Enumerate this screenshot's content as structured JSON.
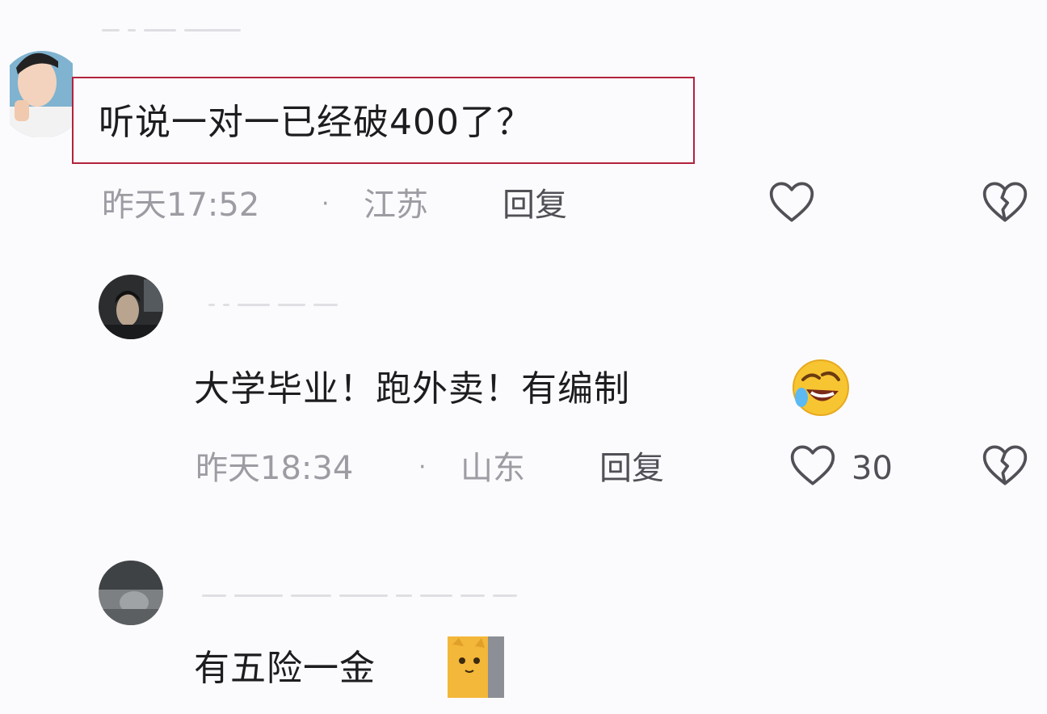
{
  "comments": [
    {
      "text": "听说一对一已经破400了？",
      "time": "昨天17:52",
      "separator": "·",
      "location": "江苏",
      "reply_label": "回复",
      "like_count": "",
      "icons": [
        "heart-outline-icon",
        "broken-heart-icon"
      ]
    },
    {
      "text": "大学毕业！跑外卖！有编制",
      "emoji": "rofl-emoji",
      "time": "昨天18:34",
      "separator": "·",
      "location": "山东",
      "reply_label": "回复",
      "like_count": "30",
      "icons": [
        "heart-outline-icon",
        "broken-heart-icon"
      ]
    },
    {
      "text": "有五险一金",
      "emoji": "cat-sticker"
    }
  ],
  "colors": {
    "highlight_border": "#b3223d",
    "meta_text": "#9c9ca3",
    "reply_text": "#505056"
  }
}
